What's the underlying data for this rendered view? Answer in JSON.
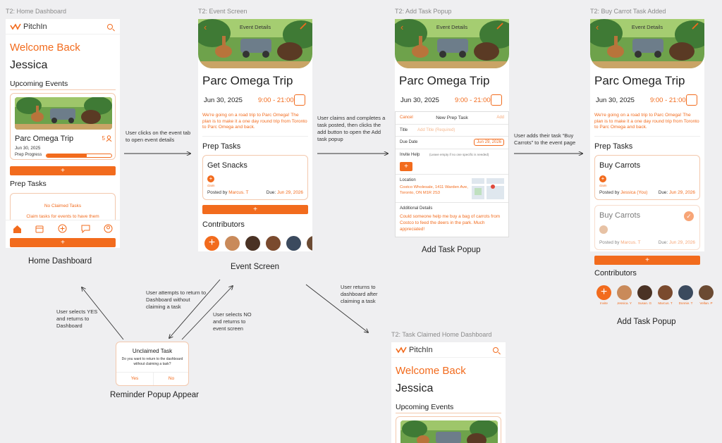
{
  "frames": {
    "home": "T2: Home Dashboard",
    "event": "T2: Event Screen",
    "add_task": "T2: Add Task Popup",
    "carrot": "T2: Buy Carrot Task Added",
    "claimed": "T2: Task Claimed Home Dashboard"
  },
  "captions": {
    "home": "Home Dashboard",
    "event": "Event Screen",
    "add_task": "Add Task Popup",
    "carrot": "Add Task Popup",
    "reminder": "Reminder Popup Appear"
  },
  "notes": {
    "n1": "User clicks on the event tab to open event details",
    "n2": "User claims and completes a task posted, then clicks the add button to open the Add task popup",
    "n3": "User adds their task “Buy Carrots” to the event page",
    "n4": "User attempts to return to Dashboard without claiming a task",
    "n5": "User selects YES and returns to Dashboard",
    "n6": "User selects NO and returns to event screen",
    "n7": "User returns to dashboard after claiming a task"
  },
  "app": {
    "name": "PitchIn",
    "welcome": "Welcome Back",
    "user": "Jessica",
    "upcoming": "Upcoming Events",
    "prep_tasks": "Prep Tasks",
    "no_claimed": "No Claimed Tasks",
    "claim_hint": "Claim tasks for events to have them",
    "prep_progress": "Prep Progress",
    "progress": 0.62,
    "people_count": "5",
    "plus": "+"
  },
  "event": {
    "header": "Event Details",
    "title": "Parc Omega Trip",
    "date": "Jun 30, 2025",
    "home_date": "Jun 30, 2025",
    "time": "9:00 - 21:00",
    "description": "We're going on a road trip to Parc Omega! The plan is to make it a one day round trip from Toronto to Parc Omega and back.",
    "prep_tasks": "Prep Tasks",
    "contributors": "Contributors",
    "claim": "claim",
    "posted_by": "Posted by",
    "due": "Due:",
    "due_date": "Jun 29, 2026",
    "tasks": [
      {
        "name": "Get Snacks",
        "poster": "Marcus. T",
        "due": "Jun 29, 2026"
      }
    ],
    "carrot_tasks": [
      {
        "name": "Buy Carrots",
        "poster": "Jessica (You)",
        "due": "Jun 29, 2026"
      },
      {
        "name": "Buy Carrots",
        "poster": "Marcus. T",
        "due": "Jun 29, 2026"
      }
    ],
    "people": [
      "Invite",
      "Jessica. Y",
      "Susan. G",
      "Marcus. T",
      "Donnie. T",
      "Vellan. P"
    ]
  },
  "popup": {
    "cancel": "Cancel",
    "title": "New Prep Task",
    "add": "Add",
    "title_label": "Title",
    "title_placeholder": "Add Title (Required)",
    "due_label": "Due Date",
    "due_value": "Jun 29, 2026",
    "invite_label": "Invite Help",
    "invite_hint": "(Leave empty if no one specific is needed)",
    "location_label": "Location",
    "location_value": "Costco Wholesale, 1411 Warden Ave, Toronto, ON M1R 2S3",
    "details_label": "Additional Details",
    "details_value": "Could someone help me buy a bag of carrots from Costco to feed the deers in the park. Much appreciated!"
  },
  "reminder": {
    "title": "Unclaimed Task",
    "body": "Do you want to return to the dashboard without claiming a task?",
    "yes": "Yes",
    "no": "No"
  },
  "colors": {
    "accent": "#f26b1d",
    "border": "#f3c8ad"
  }
}
